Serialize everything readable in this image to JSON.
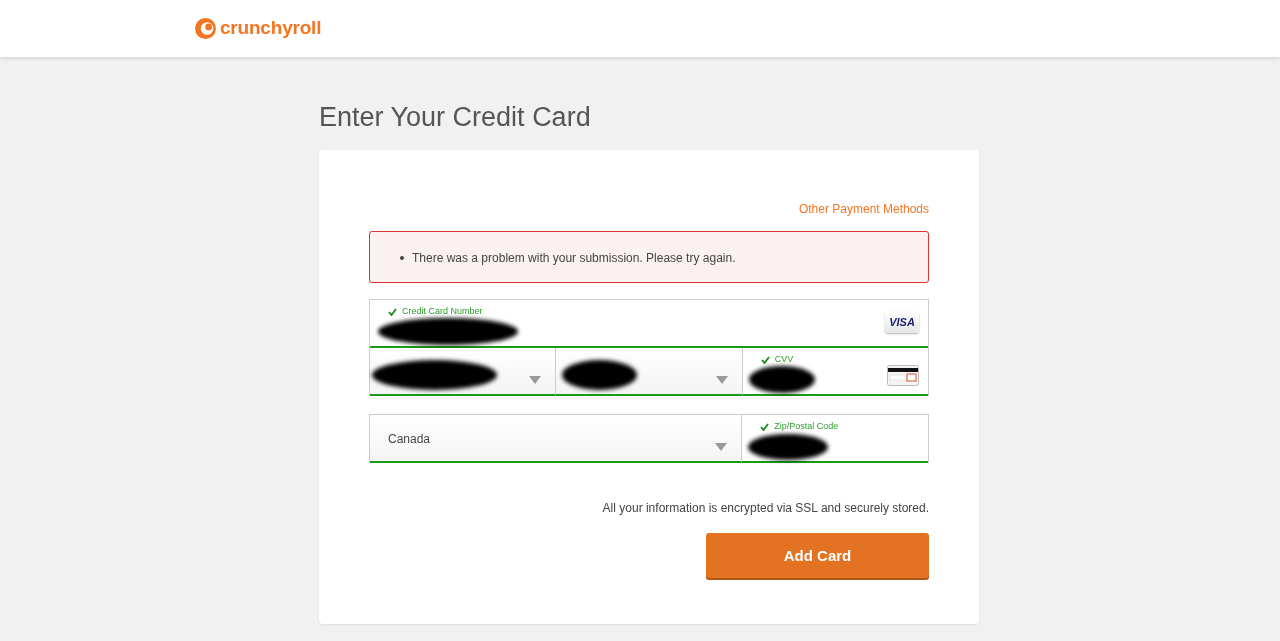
{
  "header": {
    "logo_text": "crunchyroll"
  },
  "title": "Enter Your Credit Card",
  "other_payment_link": "Other Payment Methods",
  "errors": [
    "There was a problem with your submission. Please try again."
  ],
  "rows": [
    {
      "fields": [
        {
          "kind": "text",
          "label": "Credit Card Number",
          "valid": true,
          "redacted": true,
          "card_brand": "VISA"
        }
      ]
    },
    {
      "fields": [
        {
          "kind": "select",
          "valid": true,
          "redacted": true
        },
        {
          "kind": "select",
          "valid": true,
          "redacted": true
        },
        {
          "kind": "text",
          "label": "CVV",
          "valid": true,
          "redacted": true,
          "cvv_icon": true
        }
      ]
    },
    {
      "fields": [
        {
          "kind": "select",
          "value": "Canada",
          "valid": true,
          "redacted": false,
          "wide": true
        },
        {
          "kind": "text",
          "label": "Zip/Postal Code",
          "valid": true,
          "redacted": true
        }
      ]
    }
  ],
  "security_note": "All your information is encrypted via SSL and securely stored.",
  "submit_button": "Add Card"
}
